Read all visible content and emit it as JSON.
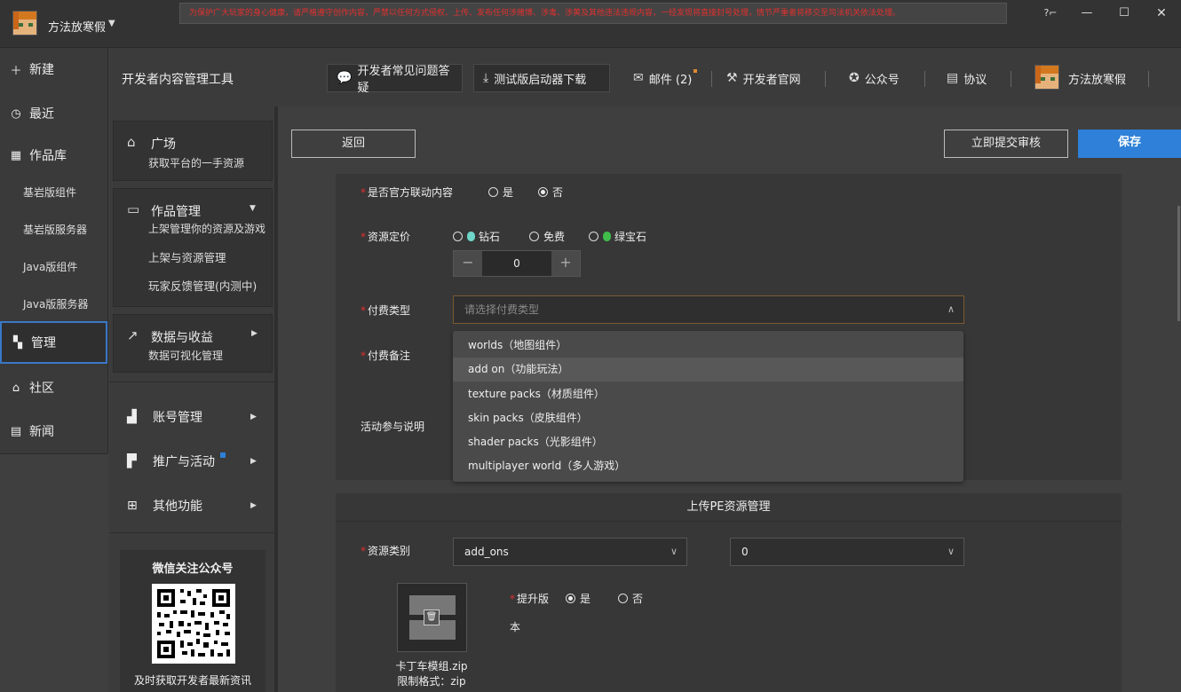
{
  "titlebar": {
    "app_name": "方法放寒假",
    "dropdown_glyph": "▼",
    "notice": "为保护广大玩家的身心健康，请严格遵守创作内容，严禁以任何方式侵权、上传、发布任何涉赌博、涉毒、涉黄及其他违法违规内容，一经发现将直接封号处理，情节严重者将移交至司法机关依法处理。",
    "help_glyph": "?⌐",
    "minimize_glyph": "—",
    "maximize_glyph": "☐",
    "close_glyph": "✕"
  },
  "leftnav": {
    "new": "新建",
    "recent": "最近",
    "library": "作品库",
    "bedrock_component": "基岩版组件",
    "bedrock_server": "基岩版服务器",
    "java_component": "Java版组件",
    "java_server": "Java版服务器",
    "manage": "管理",
    "community": "社区",
    "news": "新闻"
  },
  "topbar": {
    "page_title": "开发者内容管理工具",
    "faq": "开发者常见问题答疑",
    "test_launcher": "测试版启动器下载",
    "mail": "邮件 (2)",
    "dev_site": "开发者官网",
    "official_account": "公众号",
    "agreement": "协议",
    "user_name": "方法放寒假"
  },
  "side": {
    "plaza_title": "广场",
    "plaza_desc": "获取平台的一手资源",
    "works_title": "作品管理",
    "works_desc": "上架管理你的资源及游戏",
    "works_sub1": "上架与资源管理",
    "works_sub2": "玩家反馈管理(内测中)",
    "data_title": "数据与收益",
    "data_desc": "数据可视化管理",
    "account": "账号管理",
    "promo": "推广与活动",
    "others": "其他功能",
    "wechat_title": "微信关注公众号",
    "wechat_desc": "及时获取开发者最新资讯"
  },
  "main": {
    "back": "返回",
    "submit_review": "立即提交审核",
    "save": "保存",
    "official_collab_label": "是否官方联动内容",
    "yes": "是",
    "no": "否",
    "pricing_label": "资源定价",
    "diamond": "钻石",
    "free": "免费",
    "emerald": "绿宝石",
    "price_value": "0",
    "stepper_minus": "−",
    "stepper_plus": "+",
    "pay_type_label": "付费类型",
    "pay_type_placeholder": "请选择付费类型",
    "pay_note_label": "付费备注",
    "activity_label": "活动参与说明",
    "dropdown_options": [
      "worlds（地图组件）",
      "add on（功能玩法）",
      "texture packs（材质组件）",
      "skin packs（皮肤组件）",
      "shader packs（光影组件）",
      "multiplayer world（多人游戏）"
    ],
    "upload_section_title": "上传PE资源管理",
    "resource_type_label": "资源类别",
    "resource_type_value": "add_ons",
    "resource_sub_value": "0",
    "upgrade_label": "提升版",
    "upgrade_label_2": "本",
    "file_name": "卡丁车模组.zip",
    "file_format": "限制格式：zip",
    "trash_glyph": "🗑"
  },
  "colors": {
    "accent": "#2e80d8",
    "required": "#e0312f",
    "diamond": "#6fd6c9",
    "emerald": "#3fbf4a"
  }
}
